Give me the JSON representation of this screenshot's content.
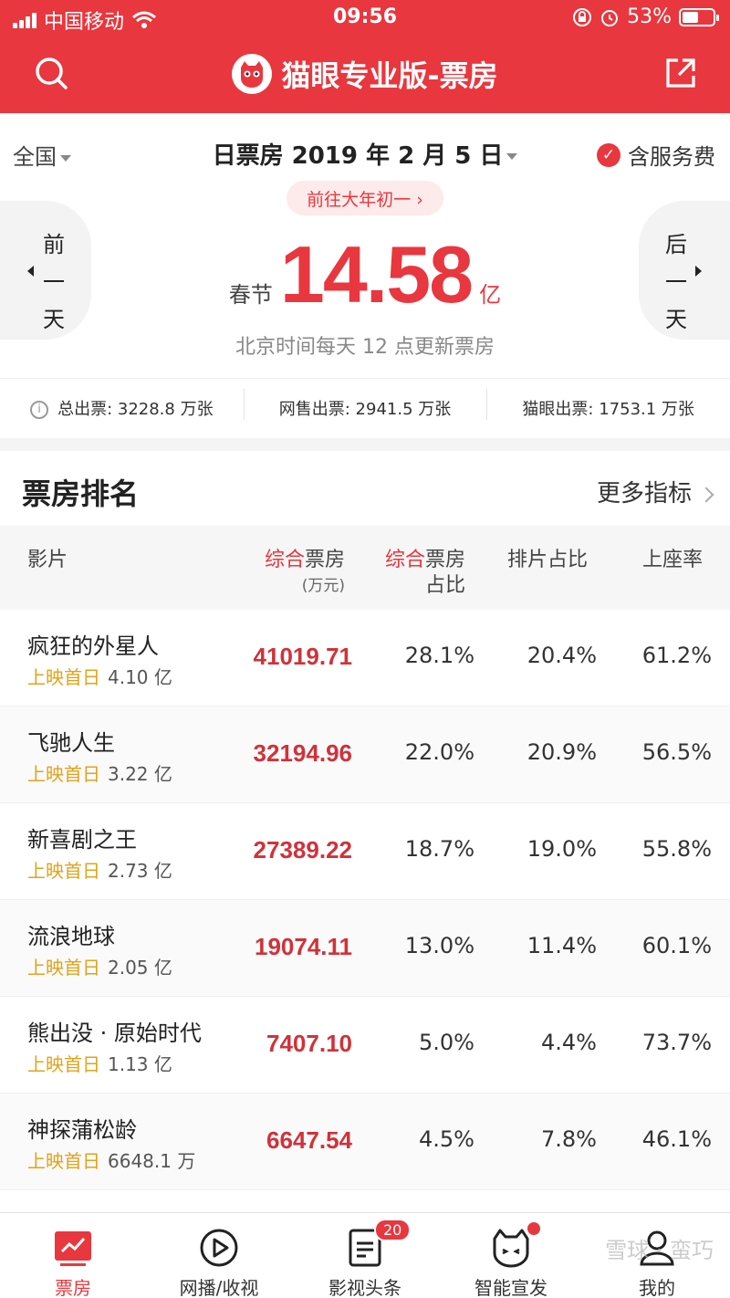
{
  "status": {
    "carrier": "中国移动",
    "time": "09:56",
    "battery": "53%",
    "battery_level": 0.53
  },
  "nav": {
    "title": "猫眼专业版-票房"
  },
  "summary": {
    "region": "全国",
    "date_title": "日票房 2019 年 2 月 5 日",
    "service_fee": "含服务费",
    "holiday_link": "前往大年初一 ›",
    "prev_day": [
      "前",
      "一",
      "天"
    ],
    "next_day": [
      "后",
      "一",
      "天"
    ],
    "festival": "春节",
    "total": "14.58",
    "unit": "亿",
    "update_note": "北京时间每天 12 点更新票房",
    "stats": {
      "total_tickets": "总出票: 3228.8 万张",
      "online_tickets": "网售出票: 2941.5 万张",
      "maoyan_tickets": "猫眼出票: 1753.1 万张"
    }
  },
  "ranking": {
    "title": "票房排名",
    "more": "更多指标",
    "headers": {
      "film": "影片",
      "boxoffice_hl": "综合",
      "boxoffice": "票房",
      "boxoffice_unit": "(万元)",
      "share_hl": "综合",
      "share": "票房",
      "share_2": "占比",
      "screening": "排片占比",
      "seat": "上座率"
    },
    "rows": [
      {
        "name": "疯狂的外星人",
        "release_label": "上映首日",
        "release_value": "4.10 亿",
        "boxoffice": "41019.71",
        "share": "28.1%",
        "screening": "20.4%",
        "seat": "61.2%"
      },
      {
        "name": "飞驰人生",
        "release_label": "上映首日",
        "release_value": "3.22 亿",
        "boxoffice": "32194.96",
        "share": "22.0%",
        "screening": "20.9%",
        "seat": "56.5%"
      },
      {
        "name": "新喜剧之王",
        "release_label": "上映首日",
        "release_value": "2.73 亿",
        "boxoffice": "27389.22",
        "share": "18.7%",
        "screening": "19.0%",
        "seat": "55.8%"
      },
      {
        "name": "流浪地球",
        "release_label": "上映首日",
        "release_value": "2.05 亿",
        "boxoffice": "19074.11",
        "share": "13.0%",
        "screening": "11.4%",
        "seat": "60.1%"
      },
      {
        "name": "熊出没 · 原始时代",
        "release_label": "上映首日",
        "release_value": "1.13 亿",
        "boxoffice": "7407.10",
        "share": "5.0%",
        "screening": "4.4%",
        "seat": "73.7%"
      },
      {
        "name": "神探蒲松龄",
        "release_label": "上映首日",
        "release_value": "6648.1 万",
        "boxoffice": "6647.54",
        "share": "4.5%",
        "screening": "7.8%",
        "seat": "46.1%"
      }
    ]
  },
  "tabs": [
    {
      "label": "票房",
      "icon": "chart-icon"
    },
    {
      "label": "网播/收视",
      "icon": "play-icon"
    },
    {
      "label": "影视头条",
      "icon": "news-icon",
      "badge": "20"
    },
    {
      "label": "智能宣发",
      "icon": "cat-icon"
    },
    {
      "label": "我的",
      "icon": "user-icon"
    }
  ],
  "watermark": "雪球 · 蛮巧",
  "colors": {
    "brand": "#e8373e",
    "release_label": "#e0a31a"
  }
}
